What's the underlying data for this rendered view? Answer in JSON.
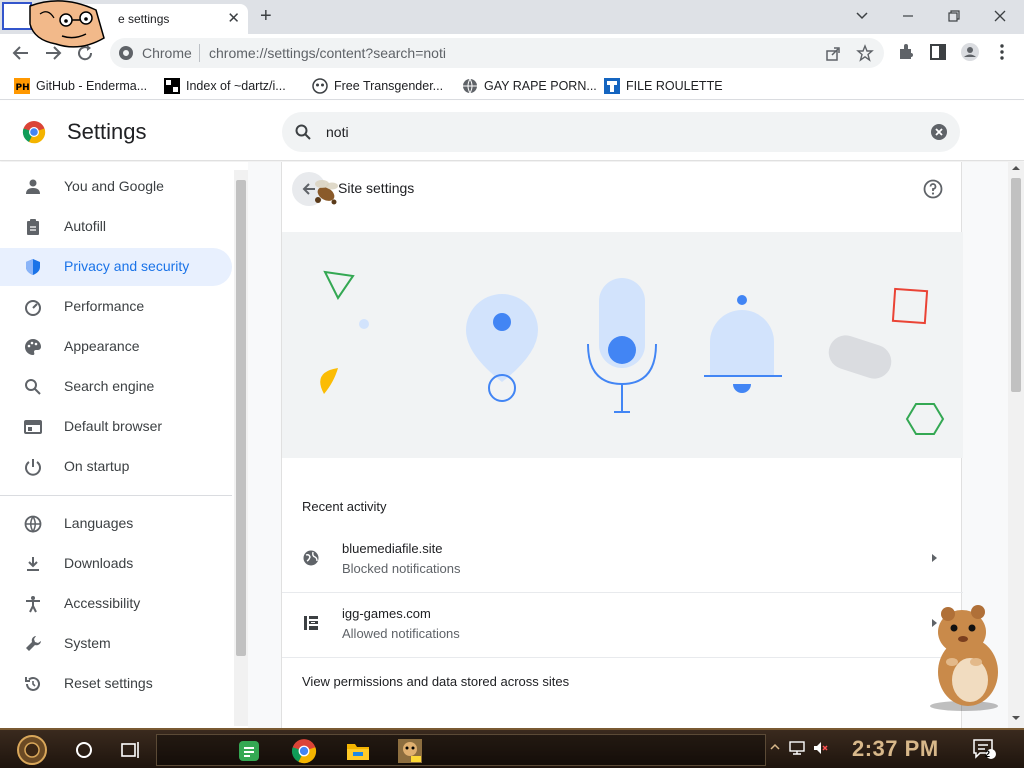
{
  "browser": {
    "tab": {
      "title": "Site settings",
      "visible_title": "e settings"
    },
    "url_prefix": "Chrome",
    "url": "chrome://settings/content?search=noti"
  },
  "bookmarks": [
    {
      "label": "GitHub - Enderma...",
      "favicon": "ph-icon"
    },
    {
      "label": "Index of ~dartz/i...",
      "favicon": "grid-icon"
    },
    {
      "label": "Free Transgender...",
      "favicon": "mask-icon"
    },
    {
      "label": "GAY RAPE PORN...",
      "favicon": "globe-icon"
    },
    {
      "label": "FILE ROULETTE",
      "favicon": "roulette-icon"
    }
  ],
  "settings": {
    "title": "Settings",
    "search_value": "noti"
  },
  "sidebar": {
    "items": [
      {
        "label": "You and Google",
        "icon": "person-icon"
      },
      {
        "label": "Autofill",
        "icon": "clipboard-icon"
      },
      {
        "label": "Privacy and security",
        "icon": "shield-icon",
        "active": true
      },
      {
        "label": "Performance",
        "icon": "gauge-icon"
      },
      {
        "label": "Appearance",
        "icon": "palette-icon"
      },
      {
        "label": "Search engine",
        "icon": "search-icon"
      },
      {
        "label": "Default browser",
        "icon": "browser-icon"
      },
      {
        "label": "On startup",
        "icon": "power-icon"
      },
      {
        "label": "Languages",
        "icon": "globe-icon"
      },
      {
        "label": "Downloads",
        "icon": "download-icon"
      },
      {
        "label": "Accessibility",
        "icon": "accessibility-icon"
      },
      {
        "label": "System",
        "icon": "wrench-icon"
      },
      {
        "label": "Reset settings",
        "icon": "reset-icon"
      }
    ]
  },
  "card": {
    "title": "Site settings",
    "recent_heading": "Recent activity",
    "rows": [
      {
        "site": "bluemediafile.site",
        "status": "Blocked notifications",
        "icon": "globe-icon"
      },
      {
        "site": "igg-games.com",
        "status": "Allowed notifications",
        "icon": "site-favicon"
      }
    ],
    "view_permissions": "View permissions and data stored across sites"
  },
  "taskbar": {
    "clock": "2:37 PM",
    "notification_count": "2",
    "apps": [
      "start-button",
      "cortana-icon",
      "task-view-icon",
      "notes-app",
      "chrome-app",
      "file-explorer-app",
      "game-app"
    ]
  },
  "colors": {
    "accent": "#1a73e8",
    "active_nav_bg": "#e8f0fe",
    "illus_blue": "#4285f4",
    "illus_light_blue": "#d2e3fc"
  }
}
